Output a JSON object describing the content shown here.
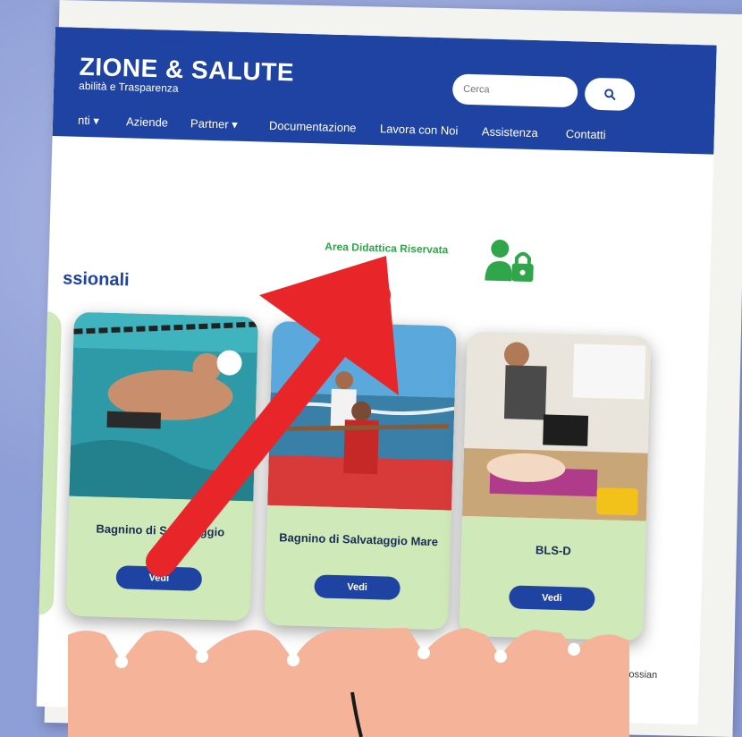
{
  "header": {
    "title": "ZIONE & SALUTE",
    "subtitle": "abilità e Trasparenza",
    "search_placeholder": "Cerca"
  },
  "nav": {
    "items": [
      "nti ▾",
      "Aziende",
      "Partner ▾",
      "Documentazione",
      "Lavora con Noi",
      "Assistenza",
      "Contatti"
    ]
  },
  "reserved_area": {
    "label": "Area Didattica Riservata"
  },
  "section": {
    "title": "ssionali"
  },
  "cards": [
    {
      "title": "Bagnino di Salvataggio",
      "button": "Vedi"
    },
    {
      "title": "Bagnino di Salvataggio Mare",
      "button": "Vedi"
    },
    {
      "title": "BLS-D",
      "button": "Vedi"
    }
  ],
  "footer_snippet": "ne possian",
  "colors": {
    "brand_blue": "#1f43a3",
    "accent_green": "#2fa64a",
    "card_green": "#cfe9b8",
    "arrow_red": "#e8262a",
    "torn_paper": "#f5b39a"
  }
}
